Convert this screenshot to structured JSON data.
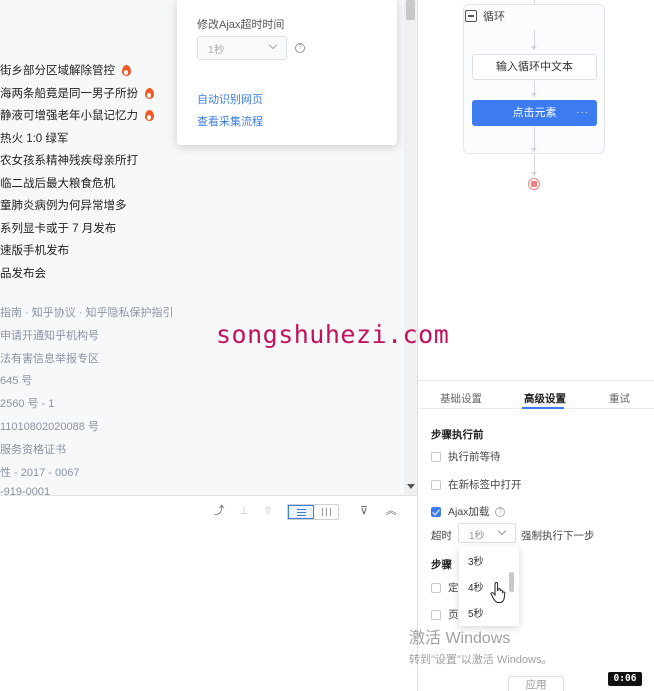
{
  "left_pane": {
    "hot_list": [
      {
        "text": "街乡部分区域解除管控",
        "hot": true
      },
      {
        "text": "海两条船竟是同一男子所扮",
        "hot": true
      },
      {
        "text": "静液可增强老年小鼠记忆力",
        "hot": true
      },
      {
        "text": "热火 1:0 绿军",
        "hot": false
      },
      {
        "text": "农女孩系精神残疾母亲所打",
        "hot": false
      },
      {
        "text": "临二战后最大粮食危机",
        "hot": false
      },
      {
        "text": "童肺炎病例为何异常增多",
        "hot": false
      },
      {
        "text": "系列显卡或于 7 月发布",
        "hot": false
      },
      {
        "text": "速版手机发布",
        "hot": false
      },
      {
        "text": "品发布会",
        "hot": false
      }
    ],
    "footer_links": [
      "指南 · 知乎协议 · 知乎隐私保护指引",
      "申请开通知乎机构号",
      "法有害信息举报专区",
      "645 号",
      "2560 号 - 1",
      "11010802020088 号",
      "服务资格证书",
      "性 - 2017 - 0067",
      "-919-0001"
    ]
  },
  "popup": {
    "title": "修改Ajax超时时间",
    "select_value": "1秒",
    "link_auto_detect": "自动识别网页",
    "link_view_flow": "查看采集流程"
  },
  "workflow": {
    "loop_label": "循环",
    "node_input": "输入循环中文本",
    "node_click": "点击元素",
    "node_click_more": "···"
  },
  "watermark": "songshuhezi.com",
  "settings": {
    "tabs": [
      "基础设置",
      "高级设置",
      "重试"
    ],
    "active_tab": "高级设置",
    "section_before": "步骤执行前",
    "wait_before": "执行前等待",
    "open_new_tab": "在新标签中打开",
    "ajax_load": "Ajax加载",
    "ajax_checked": true,
    "timeout_label": "超时",
    "timeout_value": "1秒",
    "force_next": "强制执行下一步",
    "section_after_partial": "步骤",
    "partial_row1": "定",
    "partial_row2": "页"
  },
  "dropdown": {
    "options": [
      "3秒",
      "4秒",
      "5秒"
    ]
  },
  "windows": {
    "activate_title": "激活 Windows",
    "activate_sub": "转到\"设置\"以激活 Windows。"
  },
  "apply_button": "应用",
  "video_time": "0:06",
  "colors": {
    "accent": "#3d7cf0",
    "watermark": "#c2125d",
    "fire": "#f15a22",
    "end_node": "#f08080"
  }
}
